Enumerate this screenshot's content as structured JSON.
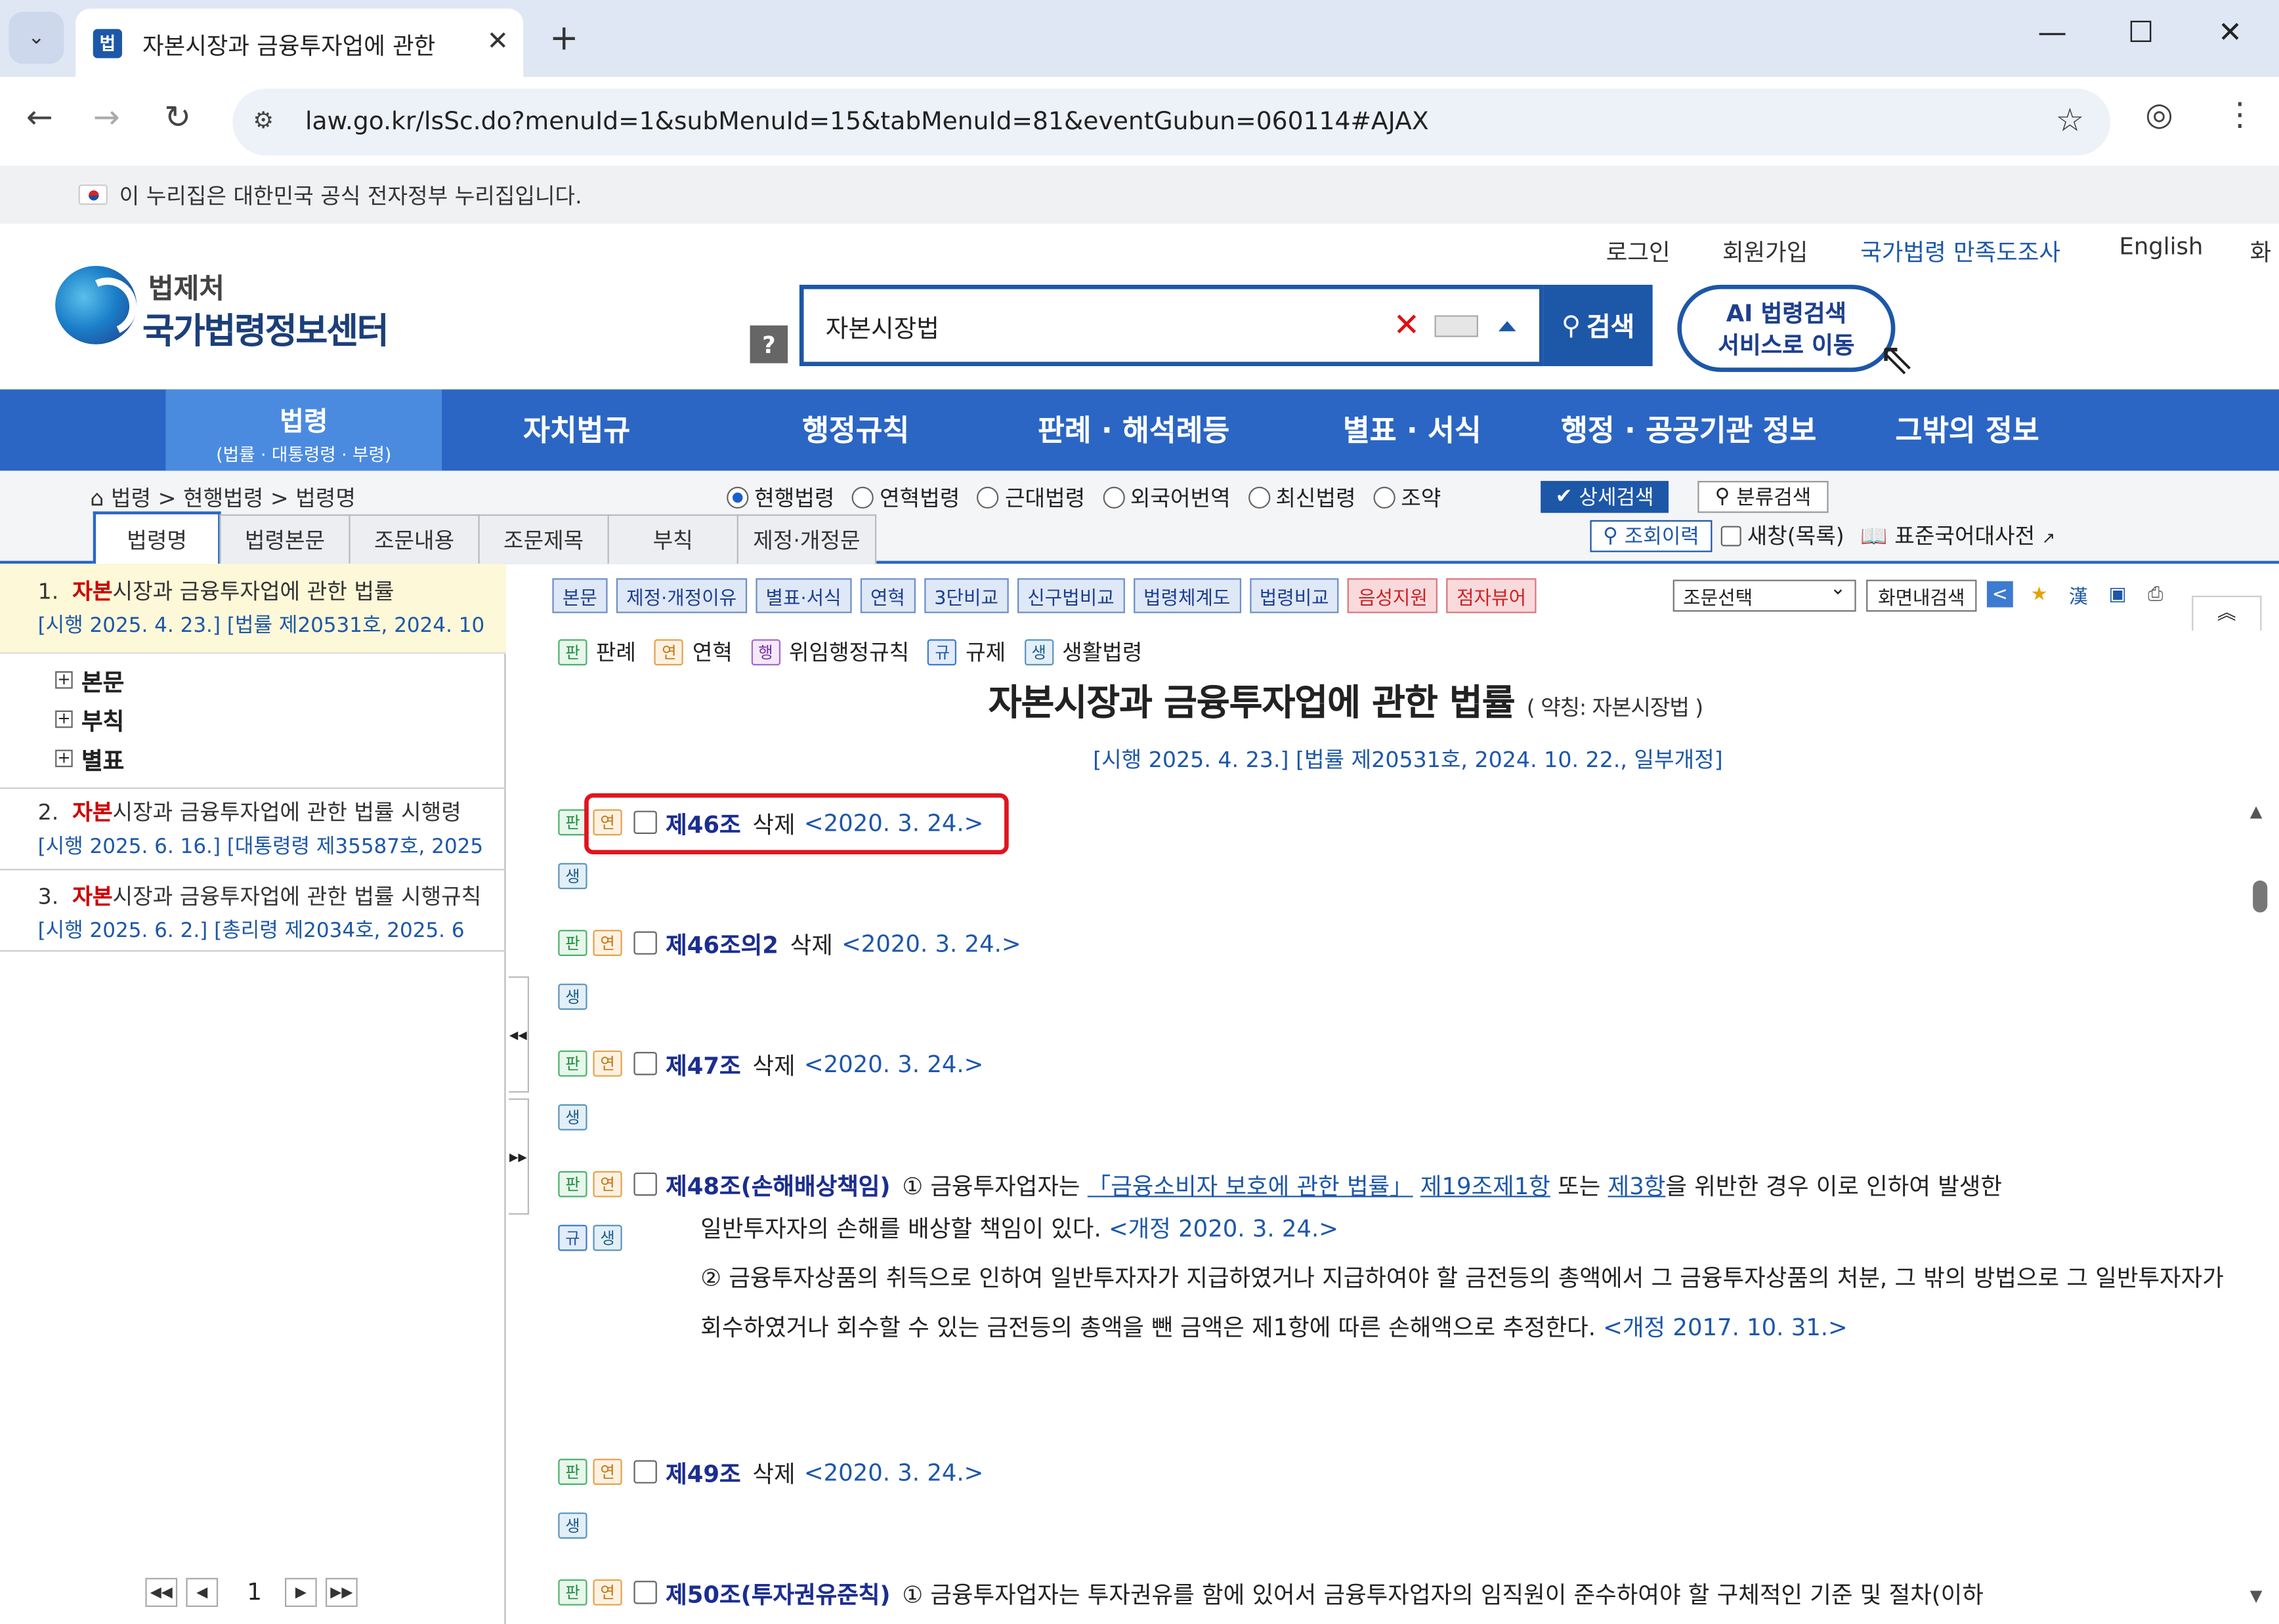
{
  "browser": {
    "tab_title": "자본시장과 금융투자업에 관한",
    "favicon_label": "법",
    "url": "law.go.kr/lsSc.do?menuId=1&subMenuId=15&tabMenuId=81&eventGubun=060114#AJAX"
  },
  "gov_banner": "이 누리집은 대한민국 공식 전자정부 누리집입니다.",
  "header": {
    "links": [
      "로그인",
      "회원가입",
      "국가법령 만족도조사",
      "English",
      "화"
    ],
    "logo_top": "법제처",
    "logo_main": "국가법령정보센터",
    "help": "?",
    "search_value": "자본시장법",
    "search_button": "검색",
    "ai_line1": "AI 법령검색",
    "ai_line2": "서비스로 이동"
  },
  "menu": {
    "active_main": "법령",
    "active_sub": "(법률 · 대통령령 · 부령)",
    "items": [
      "자치법규",
      "행정규칙",
      "판례 · 해석례등",
      "별표 · 서식",
      "행정 · 공공기관 정보",
      "그밖의 정보"
    ]
  },
  "subbar": {
    "breadcrumb": "법령 > 현행법령 > 법령명",
    "radios": [
      "현행법령",
      "연혁법령",
      "근대법령",
      "외국어번역",
      "최신법령",
      "조약"
    ],
    "detail_search": "상세검색",
    "class_search": "분류검색",
    "history": "조회이력",
    "new_window": "새창(목록)",
    "dictionary": "표준국어대사전",
    "tabs": [
      "법령명",
      "법령본문",
      "조문내용",
      "조문제목",
      "부칙",
      "제정·개정문"
    ]
  },
  "results": [
    {
      "num": "1.",
      "hl": "자본",
      "rest": "시장과 금융투자업에 관한 법률",
      "meta": "[시행 2025. 4. 23.] [법률 제20531호, 2024. 10"
    },
    {
      "num": "2.",
      "hl": "자본",
      "rest": "시장과 금융투자업에 관한 법률 시행령",
      "meta": "[시행 2025. 6. 16.] [대통령령 제35587호, 2025"
    },
    {
      "num": "3.",
      "hl": "자본",
      "rest": "시장과 금융투자업에 관한 법률 시행규칙",
      "meta": "[시행 2025. 6. 2.] [총리령 제2034호, 2025. 6"
    }
  ],
  "tree": [
    "본문",
    "부칙",
    "별표"
  ],
  "pager": {
    "page": "1"
  },
  "toolbar": {
    "buttons": [
      "본문",
      "제정·개정이유",
      "별표·서식",
      "연혁",
      "3단비교",
      "신구법비교",
      "법령체계도",
      "법령비교"
    ],
    "red_buttons": [
      "음성지원",
      "점자뷰어"
    ],
    "select": "조문선택",
    "screen_search": "화면내검색"
  },
  "legend": {
    "pan": "판례",
    "yeon": "연혁",
    "haeng": "위임행정규칙",
    "gyu": "규제",
    "saeng": "생활법령"
  },
  "badges": {
    "pan": "판",
    "yeon": "연",
    "haeng": "행",
    "gyu": "규",
    "saeng": "생"
  },
  "law": {
    "title": "자본시장과 금융투자업에 관한 법률",
    "abbrev": "( 약칭: 자본시장법 )",
    "meta": "[시행 2025. 4. 23.] [법률 제20531호, 2024. 10. 22., 일부개정]"
  },
  "articles": {
    "a46": {
      "num": "제46조",
      "del": "삭제",
      "date": "<2020. 3. 24.>"
    },
    "a46_2": {
      "num": "제46조의2",
      "del": "삭제",
      "date": "<2020. 3. 24.>"
    },
    "a47": {
      "num": "제47조",
      "del": "삭제",
      "date": "<2020. 3. 24.>"
    },
    "a48": {
      "num": "제48조(손해배상책임)",
      "p1_a": "① 금융투자업자는 ",
      "p1_link1": "「금융소비자 보호에 관한 법률」",
      "p1_link2": "제19조제1항",
      "p1_b": " 또는 ",
      "p1_link3": "제3항",
      "p1_c": "을 위반한 경우 이로 인하여 발생한",
      "p1_d": "일반투자자의 손해를 배상할 책임이 있다.",
      "p1_date": "<개정 2020. 3. 24.>",
      "p2": "② 금융투자상품의 취득으로 인하여 일반투자자가 지급하였거나 지급하여야 할 금전등의 총액에서 그 금융투자상품의 처분, 그 밖의 방법으로 그 일반투자자가 회수하였거나 회수할 수 있는 금전등의 총액을 뺀 금액은 제1항에 따른 손해액으로 추정한다.",
      "p2_date": "<개정 2017. 10. 31.>"
    },
    "a49": {
      "num": "제49조",
      "del": "삭제",
      "date": "<2020. 3. 24.>"
    },
    "a50": {
      "num": "제50조(투자권유준칙)",
      "text": "① 금융투자업자는 투자권유를 함에 있어서 금융투자업자의 임직원이 준수하여야 할 구체적인 기준 및 절차(이하"
    }
  }
}
